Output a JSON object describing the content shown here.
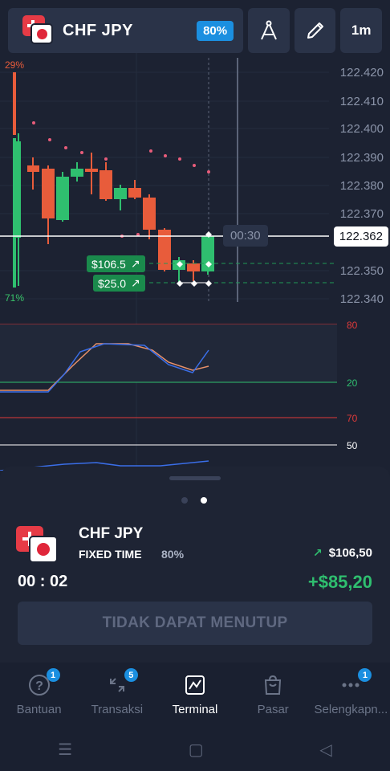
{
  "header": {
    "asset": "CHF JPY",
    "payout": "80%",
    "timeframe": "1m"
  },
  "chart": {
    "price_axis": [
      "122.420",
      "122.410",
      "122.400",
      "122.390",
      "122.380",
      "122.370",
      "122.350",
      "122.340"
    ],
    "current_price": "122.362",
    "timer": "00:30",
    "sentiment_up": "29%",
    "sentiment_down": "71%",
    "trade_tags": [
      "$106.5",
      "$25.0"
    ],
    "stochastic_levels": [
      "80",
      "20"
    ],
    "rsi_levels": [
      "70",
      "50"
    ],
    "colors": {
      "up": "#2fbf6f",
      "down": "#e85c3b",
      "accent": "#1b8fe0"
    }
  },
  "trade": {
    "asset": "CHF JPY",
    "type": "FIXED TIME",
    "payout": "80%",
    "amount": "$106,50",
    "time_left": "00 : 02",
    "profit": "+$85,20",
    "close_label": "TIDAK DAPAT MENUTUP"
  },
  "nav": {
    "items": [
      {
        "label": "Bantuan",
        "badge": "1",
        "icon": "help-icon"
      },
      {
        "label": "Transaksi",
        "badge": "5",
        "icon": "transactions-icon"
      },
      {
        "label": "Terminal",
        "badge": "",
        "icon": "terminal-icon"
      },
      {
        "label": "Pasar",
        "badge": "",
        "icon": "market-icon"
      },
      {
        "label": "Selengkapn...",
        "badge": "1",
        "icon": "more-icon"
      }
    ]
  }
}
